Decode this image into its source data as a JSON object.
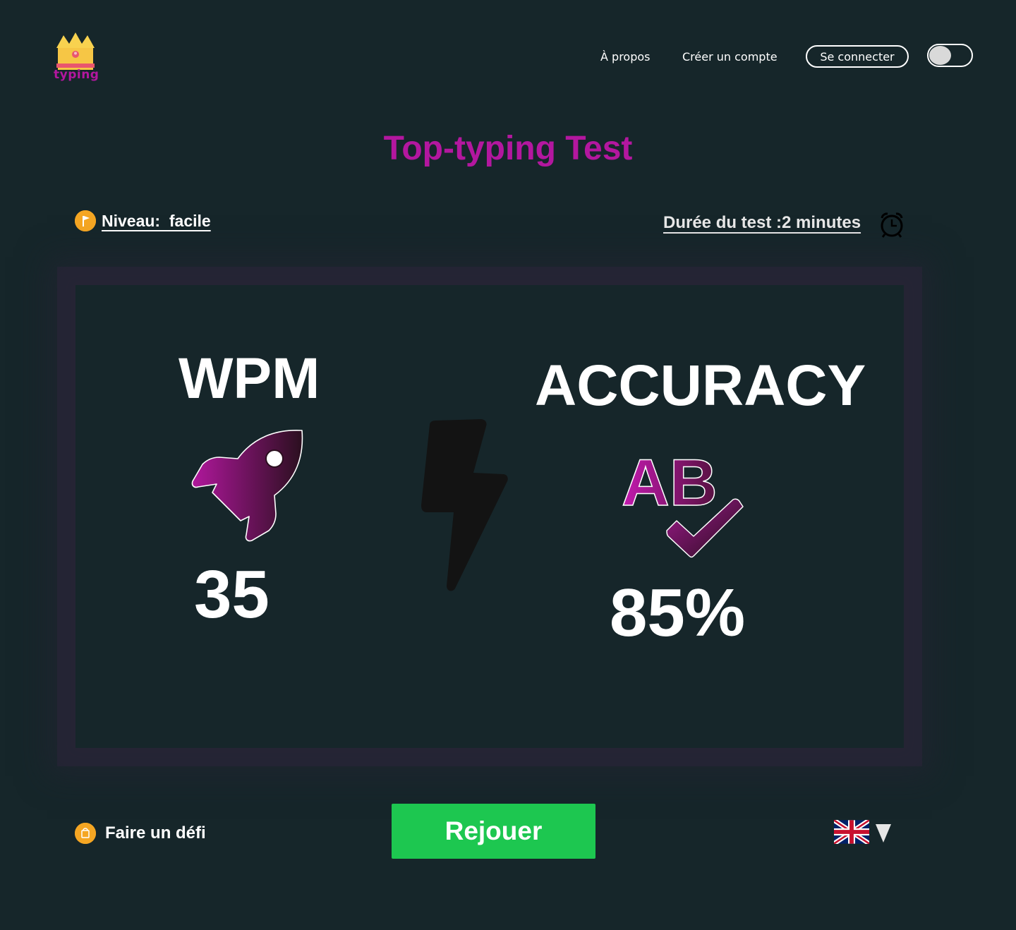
{
  "brand": {
    "logo_text": "typing",
    "accent": "#b3179f"
  },
  "nav": {
    "about": "À propos",
    "create_account": "Créer un compte",
    "login": "Se connecter",
    "theme_toggle": {
      "on": false
    }
  },
  "page": {
    "title": "Top-typing Test"
  },
  "settings": {
    "level": "Niveau:  facile",
    "duration": "Durée du test :2 minutes"
  },
  "results": {
    "wpm_label": "WPM",
    "wpm_value": "35",
    "accuracy_label": "ACCURACY",
    "accuracy_icon_text": "AB",
    "accuracy_value": "85%",
    "icons": [
      "rocket-icon",
      "lightning-icon",
      "ab-check-icon"
    ]
  },
  "footer": {
    "challenge": "Faire un défi",
    "replay": "Rejouer",
    "language_icon": "uk-flag-icon",
    "replay_color": "#1dc750"
  }
}
